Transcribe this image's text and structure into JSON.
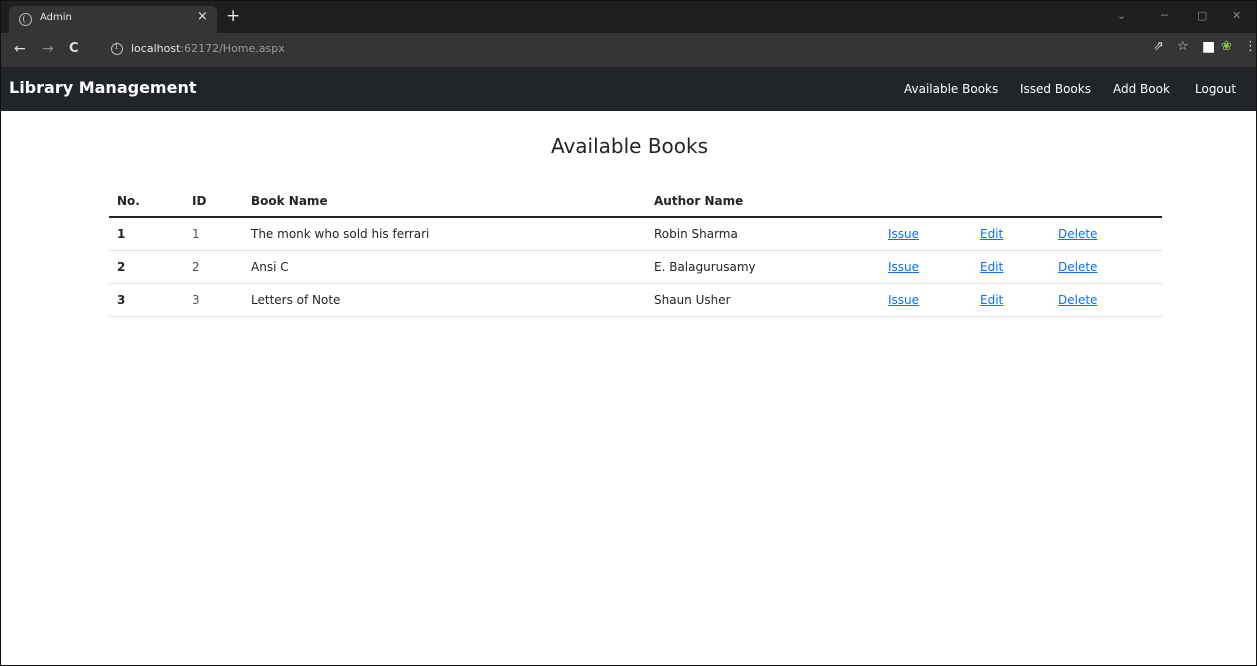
{
  "browser": {
    "tab_title": "Admin",
    "tab_close": "×",
    "new_tab": "+",
    "url_host": "localhost",
    "url_rest": ":62172/Home.aspx"
  },
  "app": {
    "brand": "Library Management",
    "nav": [
      {
        "label": "Available Books"
      },
      {
        "label": "Issed Books"
      },
      {
        "label": "Add Book"
      },
      {
        "label": "Logout"
      }
    ]
  },
  "page": {
    "heading": "Available Books"
  },
  "table": {
    "headers": [
      "No.",
      "ID",
      "Book Name",
      "Author Name"
    ],
    "rows": [
      {
        "no": "1",
        "id": "1",
        "book": "The monk who sold his ferrari",
        "author": "Robin Sharma",
        "issue": "Issue",
        "edit": "Edit",
        "delete": "Delete"
      },
      {
        "no": "2",
        "id": "2",
        "book": "Ansi C",
        "author": "E. Balagurusamy",
        "issue": "Issue",
        "edit": "Edit",
        "delete": "Delete"
      },
      {
        "no": "3",
        "id": "3",
        "book": "Letters of Note",
        "author": "Shaun Usher",
        "issue": "Issue",
        "edit": "Edit",
        "delete": "Delete"
      }
    ]
  },
  "colors": {
    "navbar": "#212529",
    "link": "#0d6efd",
    "tabbar": "#1f1f1f"
  }
}
